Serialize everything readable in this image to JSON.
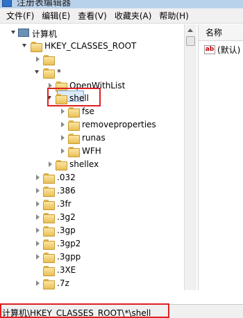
{
  "window": {
    "title": "注册表编辑器"
  },
  "menu": [
    "文件(F)",
    "编辑(E)",
    "查看(V)",
    "收藏夹(A)",
    "帮助(H)"
  ],
  "tree": {
    "root": "计算机",
    "hive": "HKEY_CLASSES_ROOT",
    "star": "*",
    "openwith": "OpenWithList",
    "shell": "shell",
    "shell_children": [
      "fse",
      "removeproperties",
      "runas",
      "WFH"
    ],
    "shellex": "shellex",
    "extensions": [
      ".032",
      ".386",
      ".3fr",
      ".3g2",
      ".3gp",
      ".3gp2",
      ".3gpp",
      ".3XE",
      ".7z"
    ]
  },
  "right_pane": {
    "column_name": "名称",
    "value_icon": "ab",
    "value_name": "(默认)"
  },
  "status": {
    "path": "计算机\\HKEY_CLASSES_ROOT\\*\\shell"
  },
  "colors": {
    "highlight_box": "#e02020",
    "selection": "#dbe9f9",
    "folder": "#e9bf55"
  }
}
